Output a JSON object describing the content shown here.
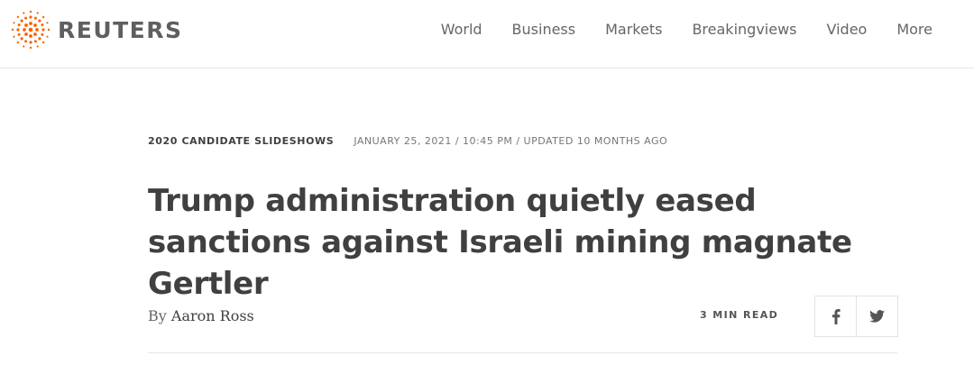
{
  "header": {
    "logo_text": "REUTERS",
    "nav": [
      "World",
      "Business",
      "Markets",
      "Breakingviews",
      "Video",
      "More"
    ]
  },
  "article": {
    "section": "2020 CANDIDATE SLIDESHOWS",
    "dateline": "JANUARY 25, 2021 / 10:45 PM / UPDATED 10 MONTHS AGO",
    "headline": "Trump administration quietly eased sanctions against Israeli mining magnate Gertler",
    "byline_prefix": "By",
    "author": "Aaron Ross",
    "read_time": "3 MIN READ"
  },
  "share": {
    "icons": [
      "facebook-icon",
      "twitter-icon"
    ]
  },
  "colors": {
    "brand_orange": "#fa6400",
    "text_dark": "#404040",
    "text_muted": "#777777",
    "divider": "#e6e6e6"
  }
}
